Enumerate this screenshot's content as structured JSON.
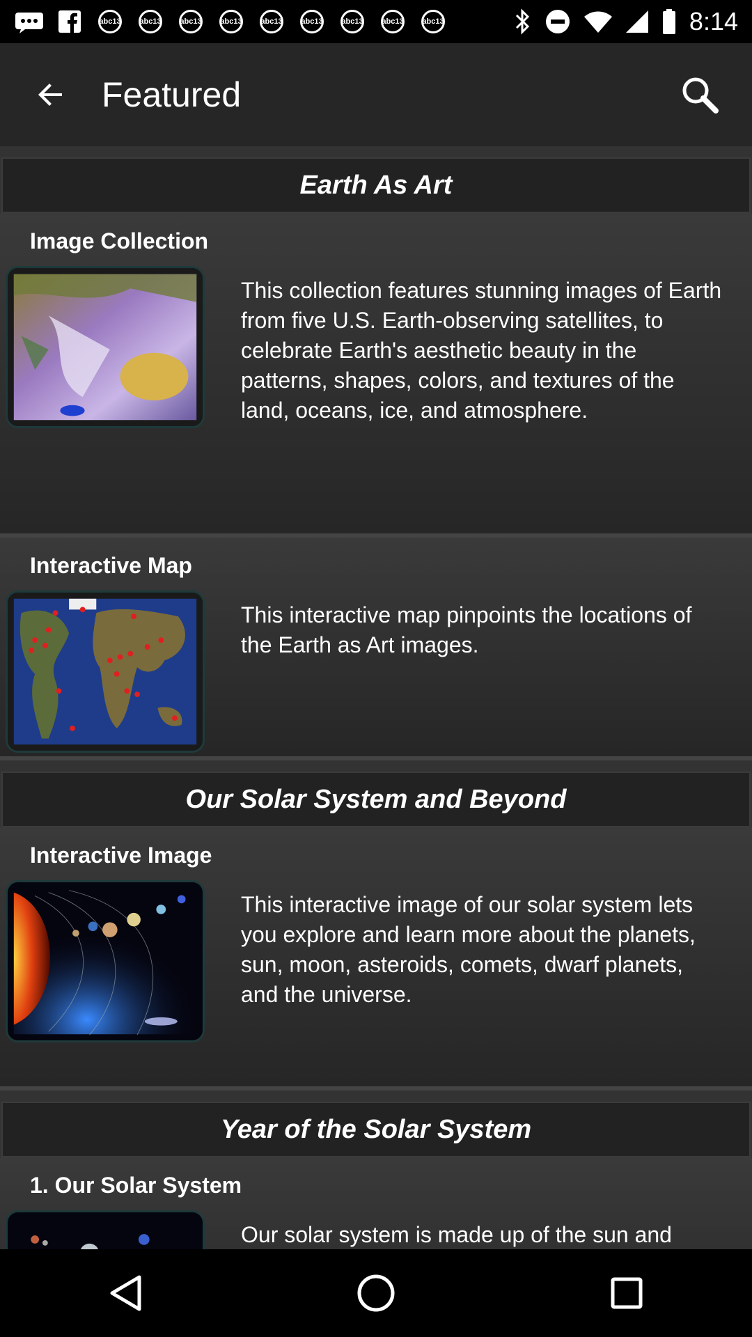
{
  "status_bar": {
    "time": "8:14",
    "notification_icons": [
      "message-icon",
      "facebook-icon",
      "abc13-icon",
      "abc13-icon",
      "abc13-icon",
      "abc13-icon",
      "abc13-icon",
      "abc13-icon",
      "abc13-icon",
      "abc13-icon",
      "abc13-icon"
    ],
    "badge_text": "abc13"
  },
  "app_bar": {
    "title": "Featured",
    "back_icon": "arrow-left-icon",
    "search_icon": "search-icon"
  },
  "sections": [
    {
      "header": "Earth As Art",
      "cards": [
        {
          "title": "Image Collection",
          "description": "This collection features stunning images of Earth from five U.S. Earth-observing satellites, to celebrate Earth's aesthetic beauty in the patterns, shapes, colors, and textures of the land, oceans, ice, and atmosphere."
        },
        {
          "title": "Interactive Map",
          "description": "This interactive map pinpoints the locations of the Earth as Art images."
        }
      ]
    },
    {
      "header": "Our Solar System and Beyond",
      "cards": [
        {
          "title": "Interactive Image",
          "description": "This interactive image of our solar system lets you explore and learn more about the planets, sun, moon, asteroids, comets, dwarf planets, and the universe."
        }
      ]
    },
    {
      "header": "Year of the Solar System",
      "cards": [
        {
          "title": "1. Our Solar System",
          "description": "Our solar system is made up of the sun and everything that travels around it."
        }
      ]
    }
  ],
  "nav_bar": {
    "back_icon": "triangle-back-icon",
    "home_icon": "circle-home-icon",
    "recents_icon": "square-recents-icon"
  }
}
